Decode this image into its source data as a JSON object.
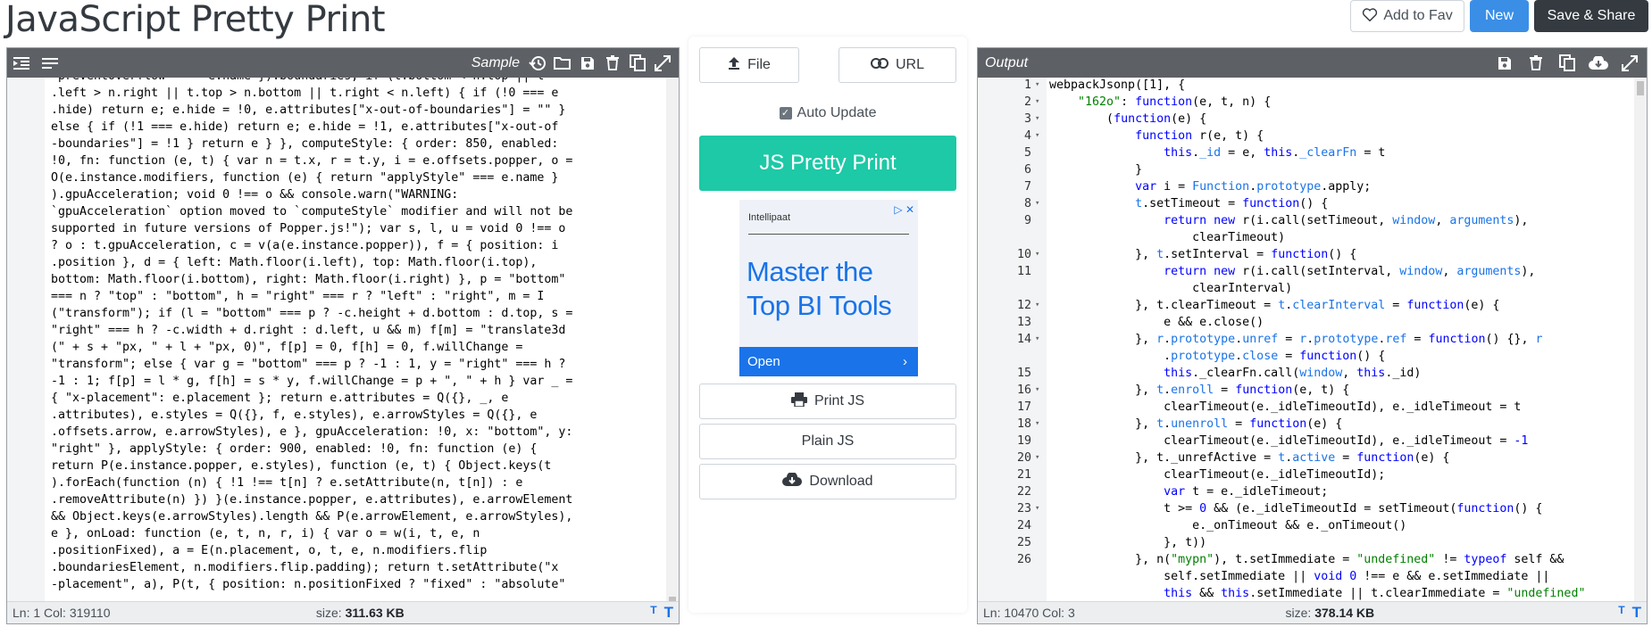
{
  "header": {
    "title": "JavaScript Pretty Print",
    "fav_label": "Add to Fav",
    "new_label": "New",
    "save_label": "Save & Share"
  },
  "input_panel": {
    "sample_label": "Sample",
    "lines": [
      "\"preventOverflow\" === e.name }).boundaries; if (t.bottom < n.top || t",
      ".left > n.right || t.top > n.bottom || t.right < n.left) { if (!0 === e",
      ".hide) return e; e.hide = !0, e.attributes[\"x-out-of-boundaries\"] = \"\" }",
      "else { if (!1 === e.hide) return e; e.hide = !1, e.attributes[\"x-out-of",
      "-boundaries\"] = !1 } return e } }, computeStyle: { order: 850, enabled:",
      "!0, fn: function (e, t) { var n = t.x, r = t.y, i = e.offsets.popper, o =",
      "O(e.instance.modifiers, function (e) { return \"applyStyle\" === e.name }",
      ").gpuAcceleration; void 0 !== o && console.warn(\"WARNING:",
      "`gpuAcceleration` option moved to `computeStyle` modifier and will not be",
      "supported in future versions of Popper.js!\"); var s, l, u = void 0 !== o",
      "? o : t.gpuAcceleration, c = v(a(e.instance.popper)), f = { position: i",
      ".position }, d = { left: Math.floor(i.left), top: Math.floor(i.top),",
      "bottom: Math.floor(i.bottom), right: Math.floor(i.right) }, p = \"bottom\"",
      "=== n ? \"top\" : \"bottom\", h = \"right\" === r ? \"left\" : \"right\", m = I",
      "(\"transform\"); if (l = \"bottom\" === p ? -c.height + d.bottom : d.top, s =",
      "\"right\" === h ? -c.width + d.right : d.left, u && m) f[m] = \"translate3d",
      "(\" + s + \"px, \" + l + \"px, 0)\", f[p] = 0, f[h] = 0, f.willChange =",
      "\"transform\"; else { var g = \"bottom\" === p ? -1 : 1, y = \"right\" === h ?",
      "-1 : 1; f[p] = l * g, f[h] = s * y, f.willChange = p + \", \" + h } var _ =",
      "{ \"x-placement\": e.placement }; return e.attributes = Q({}, _, e",
      ".attributes), e.styles = Q({}, f, e.styles), e.arrowStyles = Q({}, e",
      ".offsets.arrow, e.arrowStyles), e }, gpuAcceleration: !0, x: \"bottom\", y:",
      "\"right\" }, applyStyle: { order: 900, enabled: !0, fn: function (e) {",
      "return P(e.instance.popper, e.styles), function (e, t) { Object.keys(t",
      ").forEach(function (n) { !1 !== t[n] ? e.setAttribute(n, t[n]) : e",
      ".removeAttribute(n) }) }(e.instance.popper, e.attributes), e.arrowElement",
      "&& Object.keys(e.arrowStyles).length && P(e.arrowElement, e.arrowStyles),",
      "e }, onLoad: function (e, t, n, r, i) { var o = w(i, t, e, n",
      ".positionFixed), a = E(n.placement, o, t, e, n.modifiers.flip",
      ".boundariesElement, n.modifiers.flip.padding); return t.setAttribute(\"x",
      "-placement\", a), P(t, { position: n.positionFixed ? \"fixed\" : \"absolute\""
    ],
    "status_pos": "Ln: 1 Col: 319110",
    "size_label": "size:",
    "size_value": "311.63 KB"
  },
  "center": {
    "file_label": "File",
    "url_label": "URL",
    "auto_update_label": "Auto Update",
    "pretty_print_label": "JS Pretty Print",
    "print_label": "Print JS",
    "plain_label": "Plain JS",
    "download_label": "Download",
    "ad": {
      "brand": "Intellipaat",
      "headline_1": "Master the",
      "headline_2": "Top BI Tools",
      "cta": "Open"
    }
  },
  "output_panel": {
    "label": "Output",
    "status_pos": "Ln: 10470 Col: 3",
    "size_label": "size:",
    "size_value": "378.14 KB",
    "line_numbers": [
      "1",
      "2",
      "3",
      "4",
      "5",
      "6",
      "7",
      "8",
      "9",
      "",
      "10",
      "11",
      "",
      "12",
      "13",
      "14",
      "",
      "15",
      "16",
      "17",
      "18",
      "19",
      "20",
      "21",
      "22",
      "23",
      "24",
      "25",
      "26",
      ""
    ],
    "fold_markers": [
      "▾",
      "▾",
      "▾",
      "▾",
      "",
      "",
      "",
      "▾",
      "",
      "",
      "▾",
      "",
      "",
      "▾",
      "",
      "▾",
      "",
      "",
      "▾",
      "",
      "▾",
      "",
      "▾",
      "",
      "",
      "▾",
      "",
      "",
      "",
      ""
    ]
  },
  "colors": {
    "toolbar_bg": "#5d6166",
    "pretty_button": "#1dc9a6",
    "new_button": "#3a8ee6",
    "save_button": "#343a40",
    "keyword": "#0000ff",
    "string": "#008000"
  }
}
